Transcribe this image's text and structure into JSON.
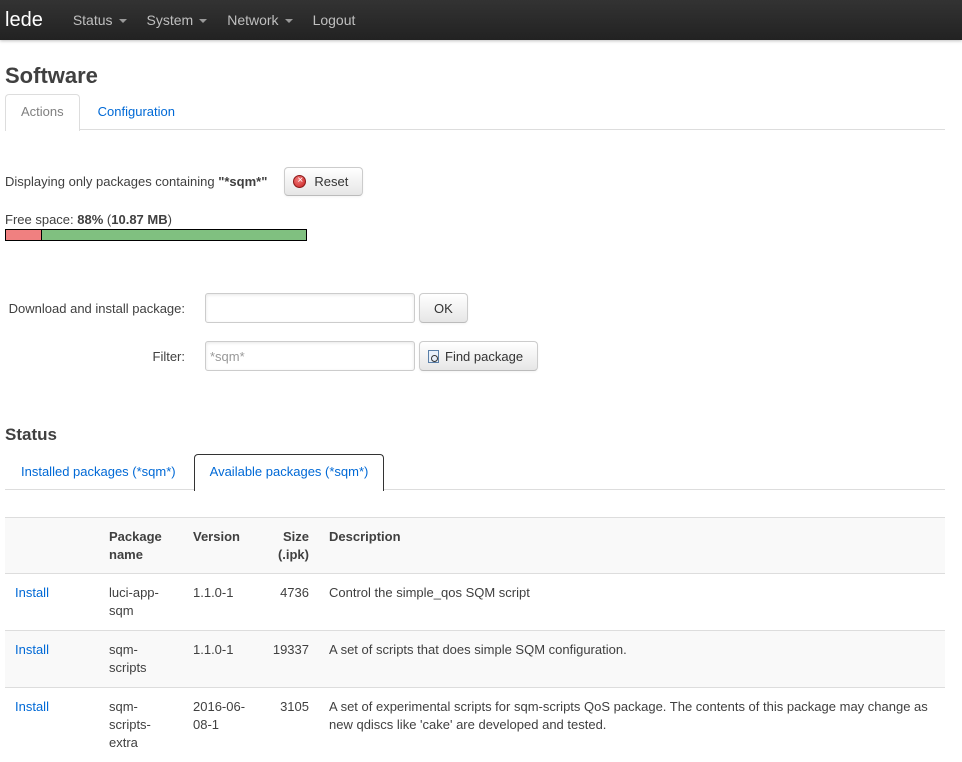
{
  "navbar": {
    "brand": "lede",
    "items": [
      {
        "label": "Status",
        "dropdown": true
      },
      {
        "label": "System",
        "dropdown": true
      },
      {
        "label": "Network",
        "dropdown": true
      },
      {
        "label": "Logout",
        "dropdown": false
      }
    ]
  },
  "page": {
    "title": "Software",
    "tabs": [
      {
        "label": "Actions",
        "active": true
      },
      {
        "label": "Configuration",
        "active": false
      }
    ]
  },
  "filter_info": {
    "prefix": "Displaying only packages containing ",
    "term": "\"*sqm*\"",
    "reset_label": "Reset"
  },
  "free_space": {
    "label": "Free space: ",
    "percent": "88%",
    "size": "10.87 MB",
    "free_fraction": 0.88
  },
  "install_form": {
    "download_label": "Download and install package:",
    "download_value": "",
    "ok_label": "OK",
    "filter_label": "Filter:",
    "filter_placeholder": "*sqm*",
    "find_label": "Find package"
  },
  "status": {
    "title": "Status",
    "tabs": [
      {
        "label": "Installed packages (*sqm*)",
        "active": false
      },
      {
        "label": "Available packages (*sqm*)",
        "active": true
      }
    ],
    "table": {
      "headers": [
        "",
        "Package name",
        "Version",
        "Size (.ipk)",
        "Description"
      ],
      "rows": [
        {
          "action": "Install",
          "name": "luci-app-sqm",
          "version": "1.1.0-1",
          "size": "4736",
          "description": "Control the simple_qos SQM script"
        },
        {
          "action": "Install",
          "name": "sqm-scripts",
          "version": "1.1.0-1",
          "size": "19337",
          "description": "A set of scripts that does simple SQM configuration."
        },
        {
          "action": "Install",
          "name": "sqm-scripts-extra",
          "version": "2016-06-08-1",
          "size": "3105",
          "description": "A set of experimental scripts for sqm-scripts QoS package. The contents of this package may change as new qdiscs like 'cake' are developed and tested."
        }
      ]
    }
  }
}
